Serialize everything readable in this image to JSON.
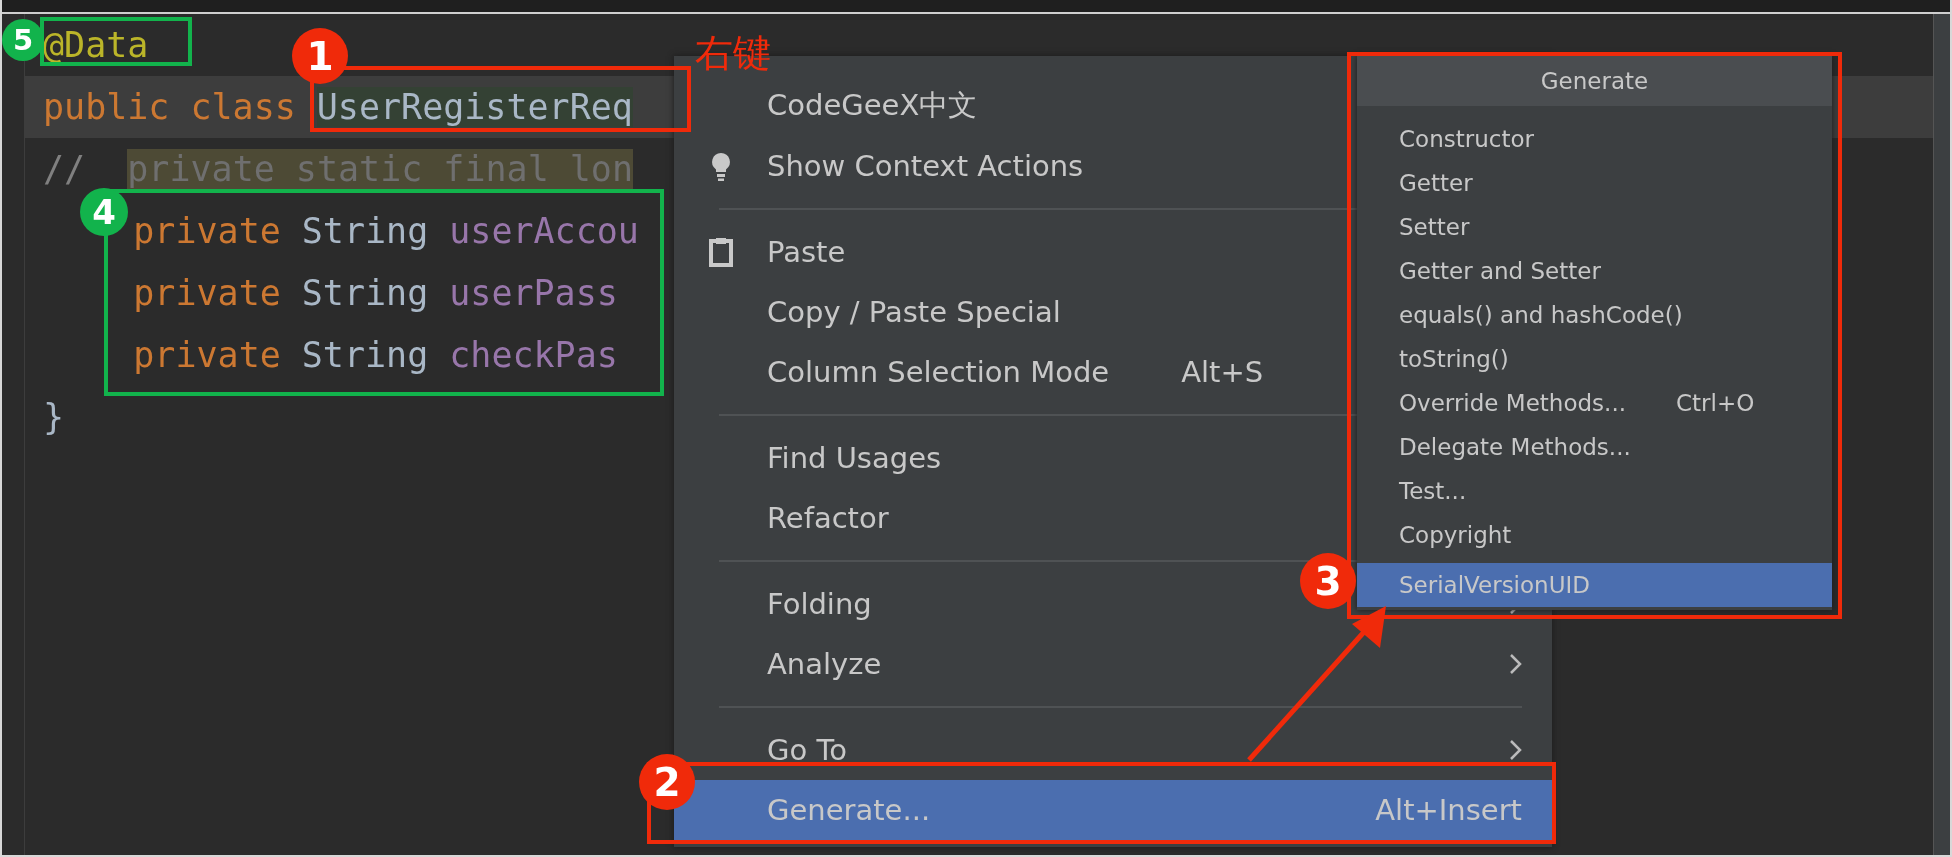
{
  "editor": {
    "lines": [
      {
        "current": false,
        "indent": false,
        "tokens": [
          {
            "kind": "annotation",
            "text": "@Data"
          }
        ]
      },
      {
        "current": true,
        "indent": false,
        "tokens": [
          {
            "kind": "keyword",
            "text": "public"
          },
          {
            "kind": "keyword",
            "text": "class"
          },
          {
            "kind": "class-name",
            "text": "UserRegisterReq"
          }
        ]
      },
      {
        "current": false,
        "indent": false,
        "tokens": [
          {
            "kind": "comment",
            "text": "//"
          },
          {
            "kind": "unused",
            "text": "private static final lon"
          }
        ]
      },
      {
        "current": false,
        "indent": true,
        "tokens": [
          {
            "kind": "keyword",
            "text": "private"
          },
          {
            "kind": "type",
            "text": "String"
          },
          {
            "kind": "field",
            "text": "userAccou"
          }
        ]
      },
      {
        "current": false,
        "indent": true,
        "tokens": [
          {
            "kind": "keyword",
            "text": "private"
          },
          {
            "kind": "type",
            "text": "String"
          },
          {
            "kind": "field",
            "text": "userPass"
          }
        ]
      },
      {
        "current": false,
        "indent": true,
        "tokens": [
          {
            "kind": "keyword",
            "text": "private"
          },
          {
            "kind": "type",
            "text": "String"
          },
          {
            "kind": "field",
            "text": "checkPas"
          }
        ]
      },
      {
        "current": false,
        "indent": false,
        "tokens": [
          {
            "kind": "plain",
            "text": "}"
          }
        ]
      }
    ]
  },
  "context_menu": {
    "items": [
      {
        "kind": "action",
        "label": "CodeGeeX中文",
        "selected": false
      },
      {
        "kind": "lightbulb-action",
        "label": "Show Context Actions",
        "selected": false
      },
      {
        "kind": "separator"
      },
      {
        "kind": "clipboard-action",
        "label": "Paste",
        "selected": false
      },
      {
        "kind": "action",
        "label": "Copy / Paste Special",
        "selected": false
      },
      {
        "kind": "action",
        "label": "Column Selection Mode",
        "shortcut": "Alt+S",
        "selected": false
      },
      {
        "kind": "separator"
      },
      {
        "kind": "action",
        "label": "Find Usages",
        "selected": false
      },
      {
        "kind": "action",
        "label": "Refactor",
        "selected": false
      },
      {
        "kind": "separator"
      },
      {
        "kind": "submenu",
        "label": "Folding",
        "selected": false
      },
      {
        "kind": "submenu",
        "label": "Analyze",
        "selected": false
      },
      {
        "kind": "separator"
      },
      {
        "kind": "submenu",
        "label": "Go To",
        "selected": false
      },
      {
        "kind": "action",
        "label": "Generate...",
        "shortcut": "Alt+Insert",
        "selected": true
      }
    ]
  },
  "generate_popup": {
    "title": "Generate",
    "items": [
      {
        "label": "Constructor",
        "selected": false
      },
      {
        "label": "Getter",
        "selected": false
      },
      {
        "label": "Setter",
        "selected": false
      },
      {
        "label": "Getter and Setter",
        "selected": false
      },
      {
        "label": "equals() and hashCode()",
        "selected": false
      },
      {
        "label": "toString()",
        "selected": false
      },
      {
        "label": "Override Methods...",
        "shortcut": "Ctrl+O",
        "selected": false
      },
      {
        "label": "Delegate Methods...",
        "selected": false
      },
      {
        "label": "Test...",
        "selected": false
      },
      {
        "label": "Copyright",
        "selected": false
      },
      {
        "label": "SerialVersionUID",
        "selected": true
      }
    ]
  },
  "annotations": {
    "note": "右键",
    "callouts": [
      {
        "number": "1",
        "color": "#f02a0a"
      },
      {
        "number": "2",
        "color": "#f02a0a"
      },
      {
        "number": "3",
        "color": "#f02a0a"
      },
      {
        "number": "4",
        "color": "#12b34c"
      },
      {
        "number": "5",
        "color": "#12b34c"
      }
    ]
  }
}
